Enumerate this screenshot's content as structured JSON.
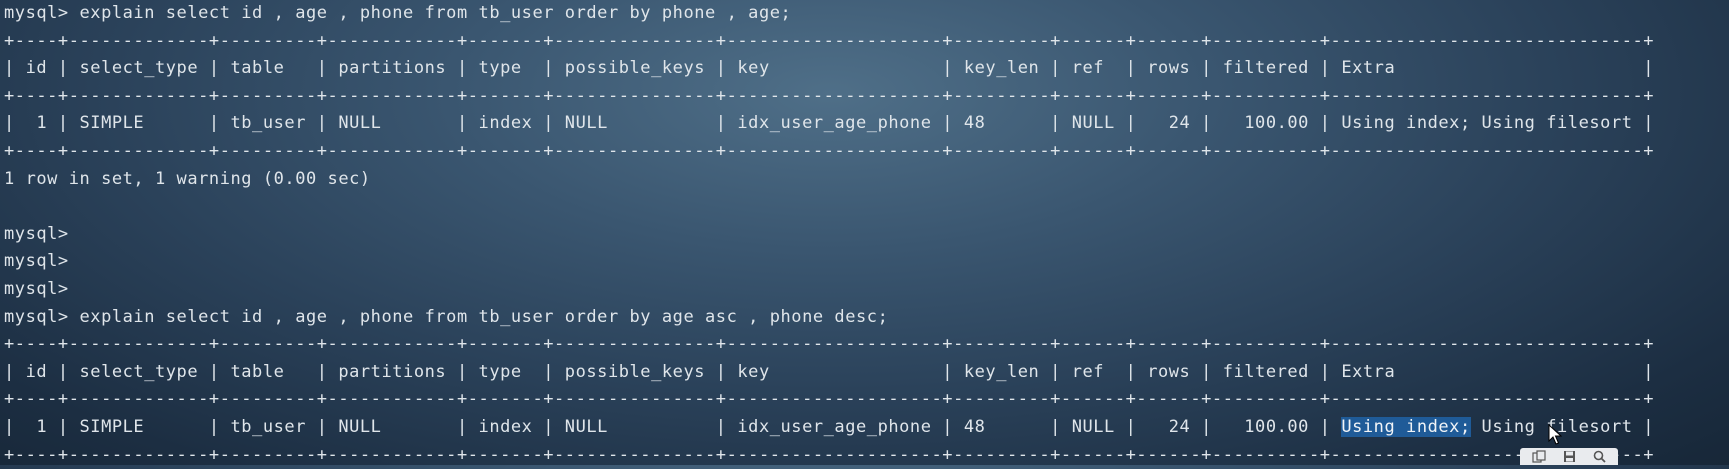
{
  "terminal": {
    "lines": [
      "mysql> explain select id , age , phone from tb_user order by phone , age;",
      "+----+-------------+---------+------------+-------+---------------+--------------------+---------+------+------+----------+-----------------------------+",
      "| id | select_type | table   | partitions | type  | possible_keys | key                | key_len | ref  | rows | filtered | Extra                       |",
      "+----+-------------+---------+------------+-------+---------------+--------------------+---------+------+------+----------+-----------------------------+",
      "|  1 | SIMPLE      | tb_user | NULL       | index | NULL          | idx_user_age_phone | 48      | NULL |   24 |   100.00 | Using index; Using filesort |",
      "+----+-------------+---------+------------+-------+---------------+--------------------+---------+------+------+----------+-----------------------------+",
      "1 row in set, 1 warning (0.00 sec)",
      "",
      "mysql>",
      "mysql>",
      "mysql>",
      "mysql> explain select id , age , phone from tb_user order by age asc , phone desc;",
      "+----+-------------+---------+------------+-------+---------------+--------------------+---------+------+------+----------+-----------------------------+",
      "| id | select_type | table   | partitions | type  | possible_keys | key                | key_len | ref  | rows | filtered | Extra                       |",
      "+----+-------------+---------+------------+-------+---------------+--------------------+---------+------+------+----------+-----------------------------+"
    ],
    "last_row": {
      "prefix": "|  1 | SIMPLE      | tb_user | NULL       | index | NULL          | idx_user_age_phone | 48      | NULL |   24 |   100.00 | ",
      "highlighted": "Using index;",
      "suffix": " Using filesort |"
    },
    "final_border": "+----+-------------+---------+------------+-------+---------------+--------------------+---------+------+------+----------+-----------------------------+"
  },
  "toolbar": {
    "icons": [
      "copy-icon",
      "save-icon",
      "search-icon"
    ]
  },
  "colors": {
    "text": "#dfe5ea",
    "selection": "#1f5b98"
  }
}
